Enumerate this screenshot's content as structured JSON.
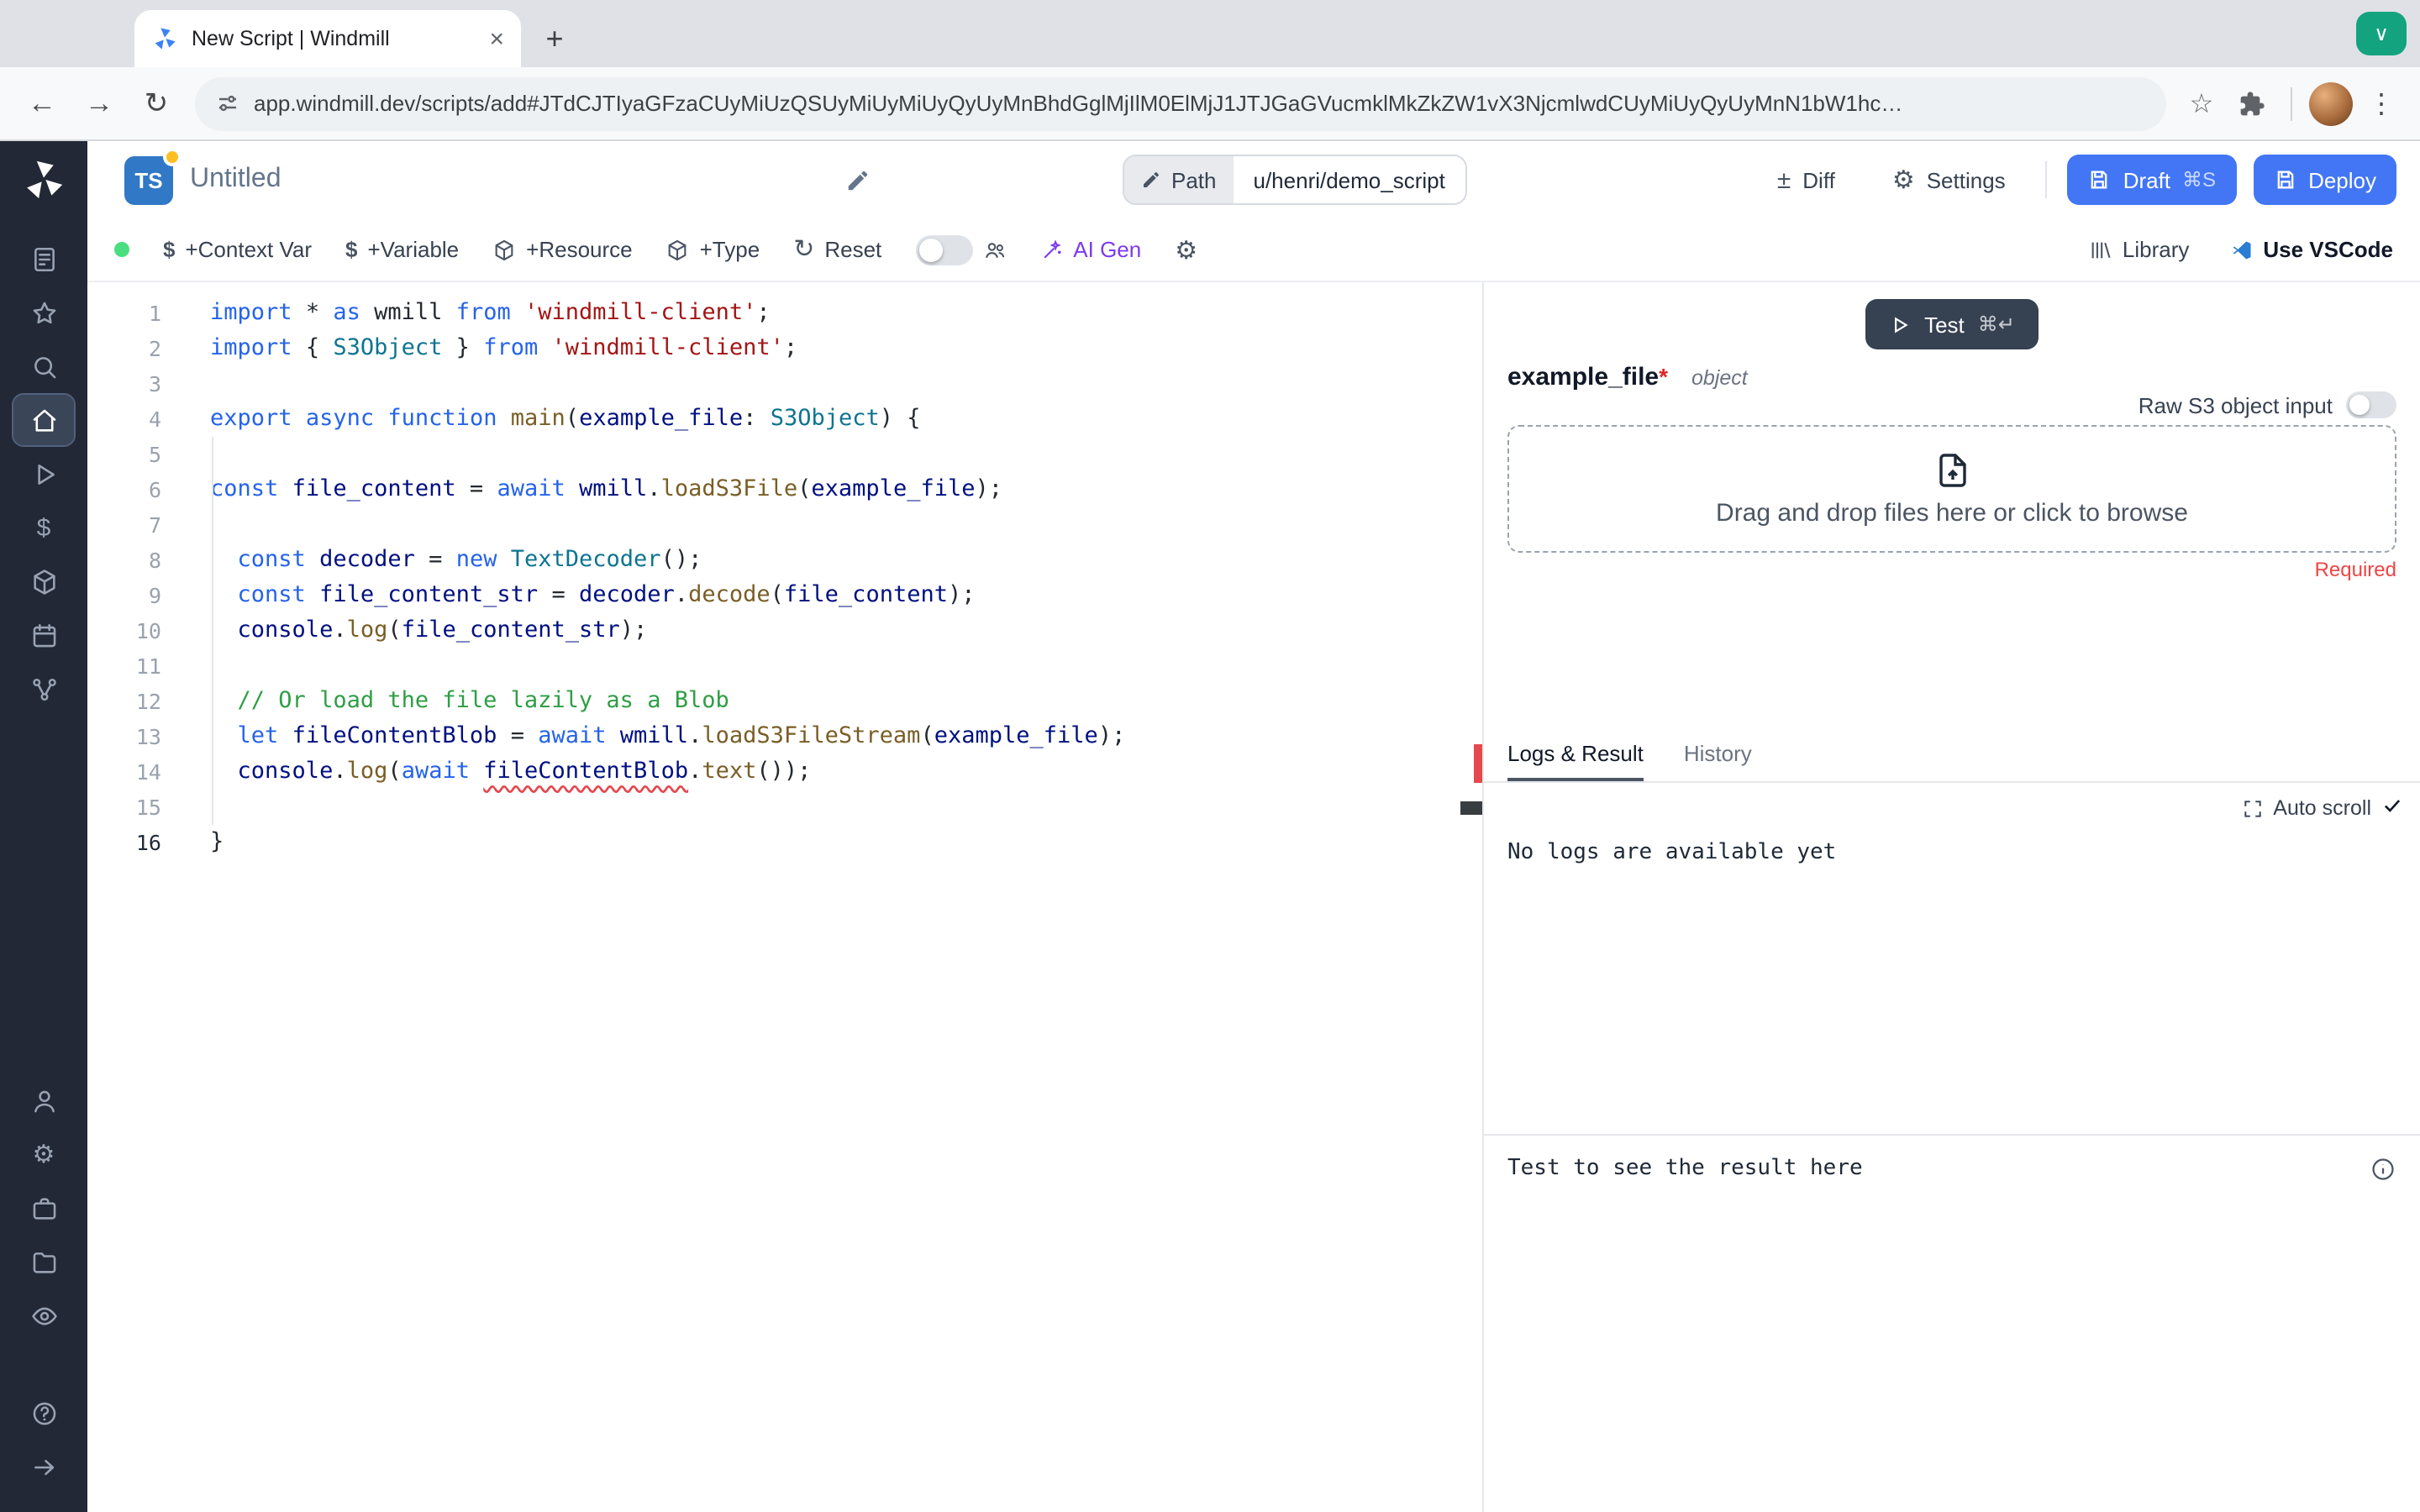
{
  "browser": {
    "tab_title": "New Script | Windmill",
    "close_tab": "×",
    "new_tab": "+",
    "back": "←",
    "forward": "→",
    "reload": "↻",
    "star": "☆",
    "menu": "⋮",
    "extension_chevron": "∨",
    "url": "app.windmill.dev/scripts/add#JTdCJTIyaGFzaCUyMiUzQSUyMiUyMiUyQyUyMnBhdGglMjIlM0ElMjJ1JTJGaGVucmklMkZkZW1vX3NjcmlwdCUyMiUyQyUyMnN1bW1hc…"
  },
  "header": {
    "lang": "TS",
    "title": "Untitled",
    "path_label": "Path",
    "path_value": "u/henri/demo_script",
    "diff_icon": "±",
    "diff_label": "Diff",
    "settings_icon": "⚙",
    "settings_label": "Settings",
    "draft_label": "Draft",
    "draft_kbd": "⌘S",
    "deploy_label": "Deploy"
  },
  "toolbar": {
    "context_var_icon": "$",
    "context_var_label": "+Context Var",
    "variable_icon": "$",
    "variable_label": "+Variable",
    "resource_label": "+Resource",
    "type_label": "+Type",
    "reset_icon": "↻",
    "reset_label": "Reset",
    "ai_gen_label": "AI Gen",
    "gear_icon": "⚙",
    "library_label": "Library",
    "vscode_label": "Use VSCode"
  },
  "sidebar": {
    "top": [
      {
        "name": "apps-icon"
      },
      {
        "name": "favorites-icon"
      },
      {
        "name": "search-icon"
      },
      {
        "name": "home-icon",
        "active": true
      },
      {
        "name": "runs-icon"
      },
      {
        "name": "variables-icon"
      },
      {
        "name": "resources-icon"
      },
      {
        "name": "schedules-icon"
      },
      {
        "name": "flows-icon"
      }
    ],
    "bottom": [
      {
        "name": "user-icon"
      },
      {
        "name": "settings-icon"
      },
      {
        "name": "workers-icon"
      },
      {
        "name": "folders-icon"
      },
      {
        "name": "audit-icon"
      },
      {
        "name": "help-icon",
        "gap": true
      },
      {
        "name": "collapse-icon"
      }
    ]
  },
  "editor": {
    "active_line": 16,
    "token_colors": {
      "k": "#2563eb",
      "s": "#a31515",
      "c": "#2f9e44",
      "t": "#0e7490",
      "f": "#795e26",
      "v": "#001080",
      "d": "#24292f",
      "e": "#001080"
    },
    "lines": [
      [
        [
          "k",
          "import"
        ],
        [
          "d",
          " * "
        ],
        [
          "k",
          "as"
        ],
        [
          "d",
          " wmill "
        ],
        [
          "k",
          "from"
        ],
        [
          "d",
          " "
        ],
        [
          "s",
          "'windmill-client'"
        ],
        [
          "d",
          ";"
        ]
      ],
      [
        [
          "k",
          "import"
        ],
        [
          "d",
          " { "
        ],
        [
          "t",
          "S3Object"
        ],
        [
          "d",
          " } "
        ],
        [
          "k",
          "from"
        ],
        [
          "d",
          " "
        ],
        [
          "s",
          "'windmill-client'"
        ],
        [
          "d",
          ";"
        ]
      ],
      [],
      [
        [
          "k",
          "export"
        ],
        [
          "d",
          " "
        ],
        [
          "k",
          "async"
        ],
        [
          "d",
          " "
        ],
        [
          "k",
          "function"
        ],
        [
          "d",
          " "
        ],
        [
          "f",
          "main"
        ],
        [
          "d",
          "("
        ],
        [
          "v",
          "example_file"
        ],
        [
          "d",
          ": "
        ],
        [
          "t",
          "S3Object"
        ],
        [
          "d",
          ") {"
        ]
      ],
      [],
      [
        [
          "k",
          "const"
        ],
        [
          "d",
          " "
        ],
        [
          "v",
          "file_content"
        ],
        [
          "d",
          " = "
        ],
        [
          "k",
          "await"
        ],
        [
          "d",
          " "
        ],
        [
          "v",
          "wmill"
        ],
        [
          "d",
          "."
        ],
        [
          "f",
          "loadS3File"
        ],
        [
          "d",
          "("
        ],
        [
          "v",
          "example_file"
        ],
        [
          "d",
          ");"
        ]
      ],
      [],
      [
        [
          "d",
          "  "
        ],
        [
          "k",
          "const"
        ],
        [
          "d",
          " "
        ],
        [
          "v",
          "decoder"
        ],
        [
          "d",
          " = "
        ],
        [
          "k",
          "new"
        ],
        [
          "d",
          " "
        ],
        [
          "t",
          "TextDecoder"
        ],
        [
          "d",
          "();"
        ]
      ],
      [
        [
          "d",
          "  "
        ],
        [
          "k",
          "const"
        ],
        [
          "d",
          " "
        ],
        [
          "v",
          "file_content_str"
        ],
        [
          "d",
          " = "
        ],
        [
          "v",
          "decoder"
        ],
        [
          "d",
          "."
        ],
        [
          "f",
          "decode"
        ],
        [
          "d",
          "("
        ],
        [
          "v",
          "file_content"
        ],
        [
          "d",
          ");"
        ]
      ],
      [
        [
          "d",
          "  "
        ],
        [
          "v",
          "console"
        ],
        [
          "d",
          "."
        ],
        [
          "f",
          "log"
        ],
        [
          "d",
          "("
        ],
        [
          "v",
          "file_content_str"
        ],
        [
          "d",
          ");"
        ]
      ],
      [],
      [
        [
          "d",
          "  "
        ],
        [
          "c",
          "// Or load the file lazily as a Blob"
        ]
      ],
      [
        [
          "d",
          "  "
        ],
        [
          "k",
          "let"
        ],
        [
          "d",
          " "
        ],
        [
          "v",
          "fileContentBlob"
        ],
        [
          "d",
          " = "
        ],
        [
          "k",
          "await"
        ],
        [
          "d",
          " "
        ],
        [
          "v",
          "wmill"
        ],
        [
          "d",
          "."
        ],
        [
          "f",
          "loadS3FileStream"
        ],
        [
          "d",
          "("
        ],
        [
          "v",
          "example_file"
        ],
        [
          "d",
          ");"
        ]
      ],
      [
        [
          "d",
          "  "
        ],
        [
          "v",
          "console"
        ],
        [
          "d",
          "."
        ],
        [
          "f",
          "log"
        ],
        [
          "d",
          "("
        ],
        [
          "k",
          "await"
        ],
        [
          "d",
          " "
        ],
        [
          "e",
          "fileContentBlob"
        ],
        [
          "d",
          "."
        ],
        [
          "f",
          "text"
        ],
        [
          "d",
          "());"
        ]
      ],
      [],
      [
        [
          "d",
          "}"
        ]
      ]
    ]
  },
  "panel": {
    "test_label": "Test",
    "test_kbd": "⌘↵",
    "arg_name": "example_file",
    "required_star": "*",
    "arg_type": "object",
    "raw_s3_label": "Raw S3 object input",
    "dropzone_text": "Drag and drop files here or click to browse",
    "required_label": "Required",
    "tab_logs": "Logs & Result",
    "tab_history": "History",
    "auto_scroll_label": "Auto scroll",
    "no_logs_text": "No logs are available yet",
    "result_placeholder": "Test to see the result here"
  },
  "colors": {
    "accent_blue": "#4276f5",
    "ai_violet": "#7c3aed",
    "error_red": "#e5484d",
    "required_red": "#ef4444",
    "success_green": "#4ade80",
    "extension_green": "#14a37f",
    "sidebar_bg": "#222836",
    "ts_badge_blue": "#3178c6"
  }
}
